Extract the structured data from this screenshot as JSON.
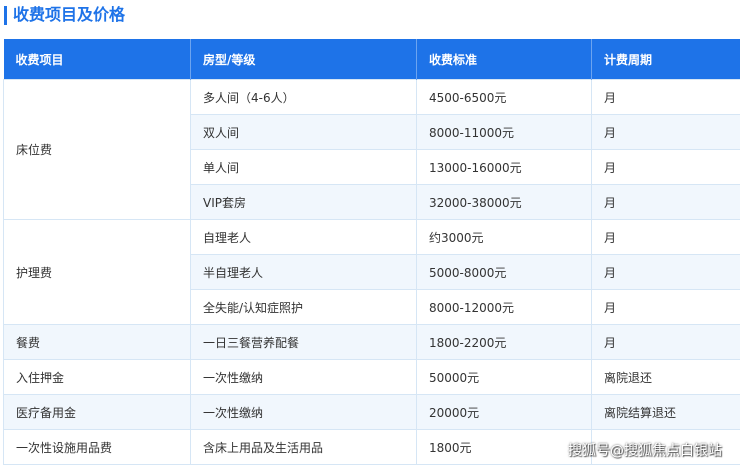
{
  "section": {
    "title": "收费项目及价格"
  },
  "colors": {
    "accent": "#1e73e8",
    "header_bg": "#1e73e8",
    "title_text": "#1e73e8",
    "alt_row_bg": "#f1f7fd",
    "border": "#d6e6f5"
  },
  "table": {
    "headers": [
      "收费项目",
      "房型/等级",
      "收费标准",
      "计费周期"
    ],
    "groups": [
      {
        "category": "床位费",
        "rows": [
          [
            "多人间（4-6人）",
            "4500-6500元",
            "月"
          ],
          [
            "双人间",
            "8000-11000元",
            "月"
          ],
          [
            "单人间",
            "13000-16000元",
            "月"
          ],
          [
            "VIP套房",
            "32000-38000元",
            "月"
          ]
        ]
      },
      {
        "category": "护理费",
        "rows": [
          [
            "自理老人",
            "约3000元",
            "月"
          ],
          [
            "半自理老人",
            "5000-8000元",
            "月"
          ],
          [
            "全失能/认知症照护",
            "8000-12000元",
            "月"
          ]
        ]
      },
      {
        "category": "餐费",
        "rows": [
          [
            "一日三餐营养配餐",
            "1800-2200元",
            "月"
          ]
        ]
      },
      {
        "category": "入住押金",
        "rows": [
          [
            "一次性缴纳",
            "50000元",
            "离院退还"
          ]
        ]
      },
      {
        "category": "医疗备用金",
        "rows": [
          [
            "一次性缴纳",
            "20000元",
            "离院结算退还"
          ]
        ]
      },
      {
        "category": "一次性设施用品费",
        "rows": [
          [
            "含床上用品及生活用品",
            "1800元",
            ""
          ]
        ]
      }
    ]
  },
  "watermark": {
    "text": "搜狐号@搜狐焦点白银站"
  }
}
